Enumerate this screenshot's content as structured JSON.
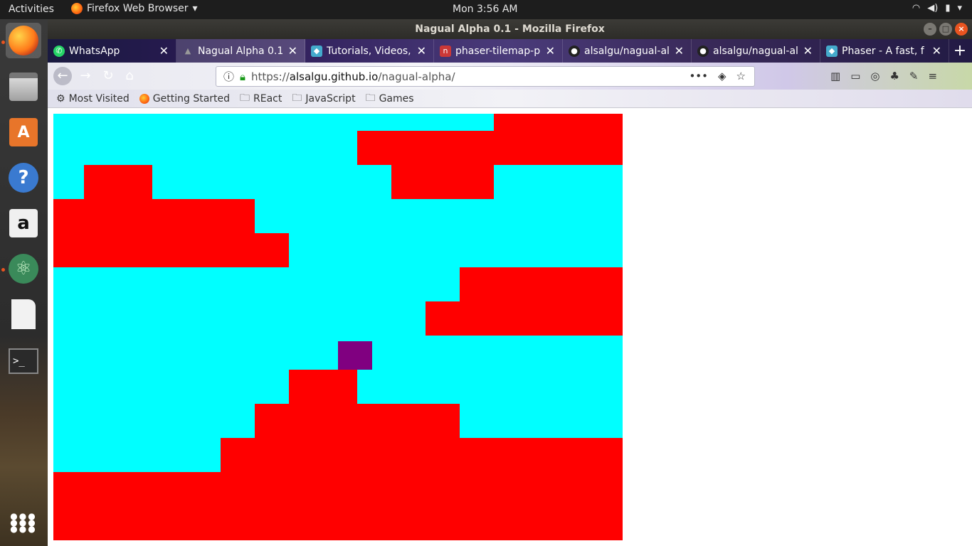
{
  "system": {
    "activities": "Activities",
    "app_menu": "Firefox Web Browser",
    "clock": "Mon  3:56 AM"
  },
  "window": {
    "title": "Nagual Alpha 0.1 - Mozilla Firefox"
  },
  "tabs": [
    {
      "label": "WhatsApp",
      "icon": "whatsapp-icon"
    },
    {
      "label": "Nagual Alpha 0.1",
      "icon": "nagual-icon"
    },
    {
      "label": "Tutorials, Videos,",
      "icon": "phaser-icon"
    },
    {
      "label": "phaser-tilemap-p",
      "icon": "npm-icon"
    },
    {
      "label": "alsalgu/nagual-al",
      "icon": "github-icon"
    },
    {
      "label": "alsalgu/nagual-al",
      "icon": "github-icon"
    },
    {
      "label": "Phaser - A fast, f",
      "icon": "phaser-icon"
    }
  ],
  "address": {
    "scheme": "https://",
    "host": "alsalgu.github.io",
    "path": "/nagual-alpha/"
  },
  "bookmarks": [
    {
      "label": "Most Visited",
      "icon": "gear-icon"
    },
    {
      "label": "Getting Started",
      "icon": "firefox-icon"
    },
    {
      "label": "REact",
      "icon": "folder-icon"
    },
    {
      "label": "JavaScript",
      "icon": "folder-icon"
    },
    {
      "label": "Games",
      "icon": "folder-icon"
    }
  ],
  "game": {
    "background_color": "#00ffff",
    "wall_color": "#ff0000",
    "player_color": "#800080"
  }
}
